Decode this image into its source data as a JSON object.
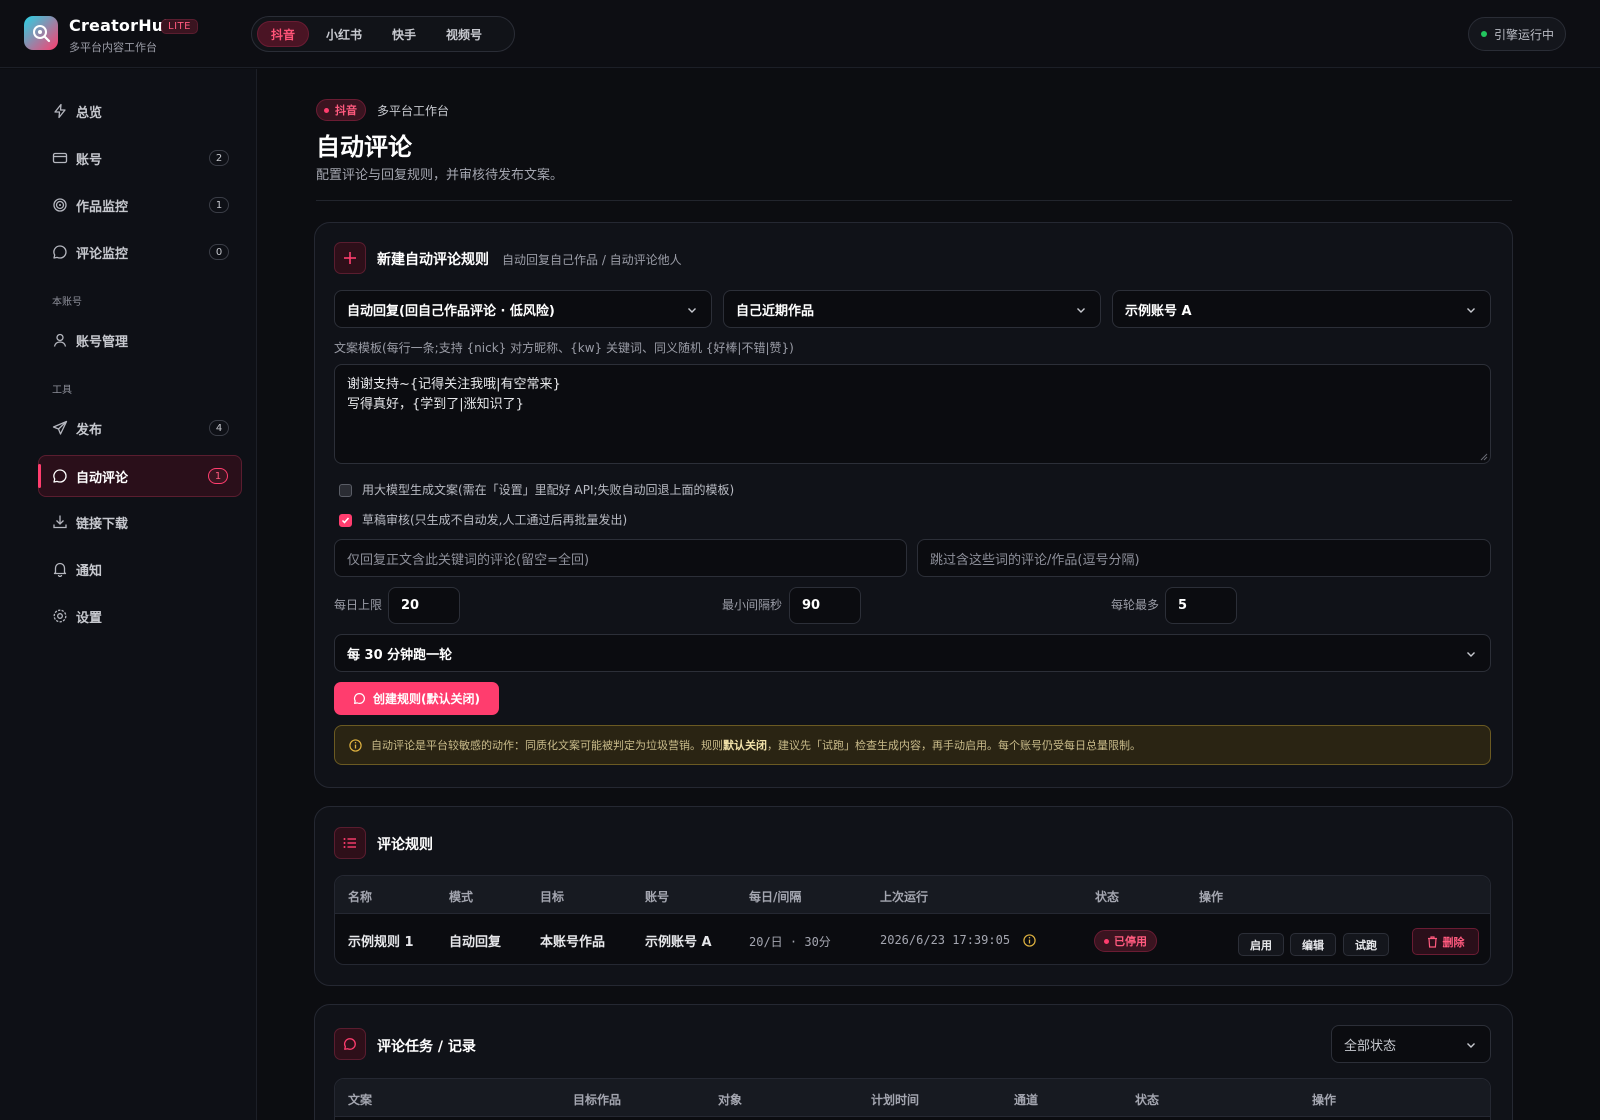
{
  "app": {
    "name": "CreatorHub",
    "badge": "LITE",
    "subtitle": "多平台内容工作台"
  },
  "platform_tabs": [
    {
      "label": "抖音",
      "active": true
    },
    {
      "label": "小红书",
      "active": false
    },
    {
      "label": "快手",
      "active": false
    },
    {
      "label": "视频号",
      "active": false
    }
  ],
  "engine_status": "引擎运行中",
  "sidebar": {
    "items": [
      {
        "label": "总览",
        "icon": "bolt-icon"
      },
      {
        "label": "账号",
        "icon": "card-icon",
        "count": "2"
      },
      {
        "label": "作品监控",
        "icon": "target-icon",
        "count": "1"
      },
      {
        "label": "评论监控",
        "icon": "chat-icon",
        "count": "0"
      }
    ],
    "section_account": "本账号",
    "account_items": [
      {
        "label": "账号管理",
        "icon": "user-icon"
      }
    ],
    "section_tools": "工具",
    "tool_items": [
      {
        "label": "发布",
        "icon": "send-icon",
        "count": "4"
      },
      {
        "label": "自动评论",
        "icon": "chat-icon",
        "count": "1",
        "active": true
      },
      {
        "label": "链接下载",
        "icon": "download-icon"
      },
      {
        "label": "通知",
        "icon": "bell-icon"
      },
      {
        "label": "设置",
        "icon": "gear-icon"
      }
    ]
  },
  "page": {
    "badge": "抖音",
    "breadcrumb": "多平台工作台",
    "title": "自动评论",
    "subtitle": "配置评论与回复规则，并审核待发布文案。"
  },
  "new_rule": {
    "title": "新建自动评论规则",
    "subtitle": "自动回复自己作品 / 自动评论他人",
    "mode_select": "自动回复(回自己作品评论 · 低风险)",
    "target_select": "自己近期作品",
    "account_select": "示例账号 A",
    "template_label": "文案模板(每行一条;支持 {nick} 对方昵称、{kw} 关键词、同义随机 {好棒|不错|赞})",
    "template_lines": [
      "谢谢支持~{记得关注我哦|有空常来}",
      "写得真好，{学到了|涨知识了}"
    ],
    "llm_checkbox": {
      "label": "用大模型生成文案(需在「设置」里配好 API;失败自动回退上面的模板)",
      "checked": false
    },
    "review_checkbox": {
      "label": "草稿审核(只生成不自动发,人工通过后再批量发出)",
      "checked": true
    },
    "keyword_placeholder": "仅回复正文含此关键词的评论(留空=全回)",
    "skip_placeholder": "跳过含这些词的评论/作品(逗号分隔)",
    "daily_limit_label": "每日上限",
    "daily_limit": "20",
    "interval_label": "最小间隔秒",
    "interval": "90",
    "per_round_label": "每轮最多",
    "per_round": "5",
    "schedule_select": "每 30 分钟跑一轮",
    "create_button": "创建规则(默认关闭)",
    "warning_pre": "自动评论是平台较敏感的动作：同质化文案可能被判定为垃圾营销。规则",
    "warning_bold": "默认关闭",
    "warning_post": "，建议先「试跑」检查生成内容，再手动启用。每个账号仍受每日总量限制。"
  },
  "rules": {
    "title": "评论规则",
    "columns": [
      "名称",
      "模式",
      "目标",
      "账号",
      "每日/间隔",
      "上次运行",
      "状态",
      "操作"
    ],
    "rows": [
      {
        "name": "示例规则 1",
        "mode": "自动回复",
        "target": "本账号作品",
        "account": "示例账号 A",
        "limit": "20/日 · 30分",
        "last_run": "2026/6/23 17:39:05",
        "status": "已停用",
        "actions": {
          "enable": "启用",
          "edit": "编辑",
          "trial": "试跑",
          "delete": "删除"
        }
      }
    ]
  },
  "tasks": {
    "title": "评论任务 / 记录",
    "filter": "全部状态",
    "columns": [
      "文案",
      "目标作品",
      "对象",
      "计划时间",
      "通道",
      "状态",
      "操作"
    ]
  },
  "colors": {
    "accent": "#ff3d6e",
    "accent_dark": "#3a1420",
    "running": "#22c55e",
    "warning_bg": "#2a2413"
  }
}
